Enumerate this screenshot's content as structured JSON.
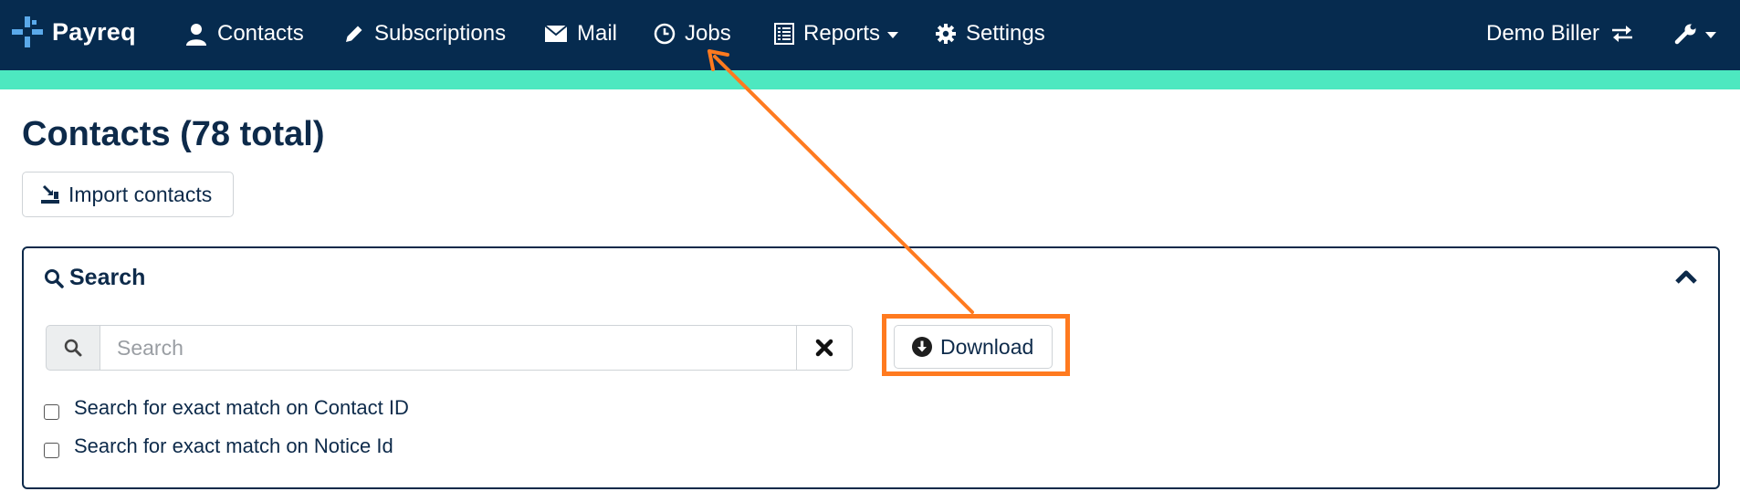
{
  "colors": {
    "navbar_bg": "#062b4f",
    "accent_bar": "#4de8c0",
    "brand_icon": "#5aa9ea",
    "primary_text": "#0d2a4a",
    "highlight": "#ff7a1f"
  },
  "navbar": {
    "brand": "Payreq",
    "items": [
      {
        "label": "Contacts",
        "icon": "user-icon"
      },
      {
        "label": "Subscriptions",
        "icon": "pencil-icon"
      },
      {
        "label": "Mail",
        "icon": "envelope-icon"
      },
      {
        "label": "Jobs",
        "icon": "clock-icon"
      },
      {
        "label": "Reports",
        "icon": "list-icon"
      },
      {
        "label": "Settings",
        "icon": "gear-icon"
      }
    ],
    "account": "Demo Biller"
  },
  "page": {
    "title": "Contacts (78 total)",
    "import_label": "Import contacts"
  },
  "search": {
    "title": "Search",
    "placeholder": "Search",
    "value": "",
    "download_label": "Download",
    "options": [
      {
        "label": "Search for exact match on Contact ID",
        "checked": false
      },
      {
        "label": "Search for exact match on Notice Id",
        "checked": false
      }
    ]
  }
}
